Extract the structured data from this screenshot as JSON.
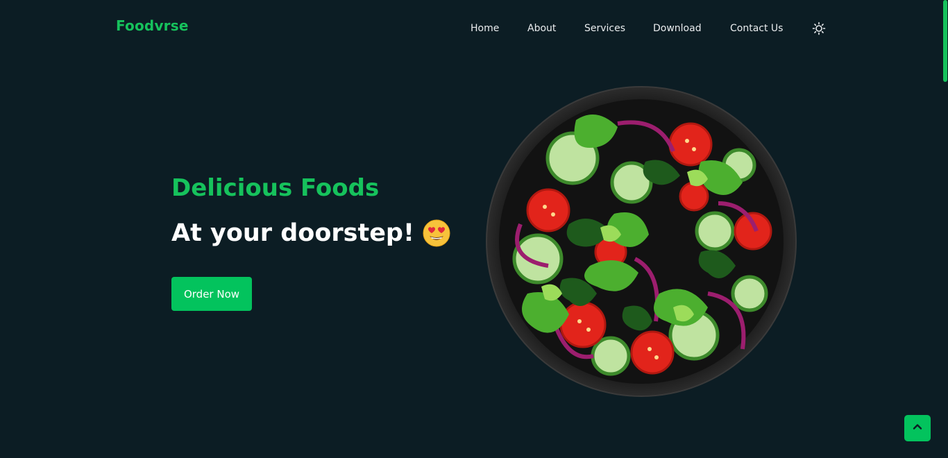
{
  "brand": {
    "name": "Foodvrse",
    "color": "#16c25c"
  },
  "nav": {
    "items": [
      {
        "label": "Home"
      },
      {
        "label": "About"
      },
      {
        "label": "Services"
      },
      {
        "label": "Download"
      },
      {
        "label": "Contact Us"
      }
    ],
    "theme_toggle_icon": "sun-icon"
  },
  "hero": {
    "title": "Delicious Foods",
    "subtitle": "At your doorstep!",
    "emoji_icon": "heart-eyes-emoji-icon",
    "cta_label": "Order Now",
    "image_icon": "salad-bowl-image"
  },
  "back_to_top_icon": "chevron-up-icon",
  "colors": {
    "background": "#0c1d24",
    "accent": "#16c25c",
    "button": "#03c35d",
    "text": "#ffffff"
  }
}
